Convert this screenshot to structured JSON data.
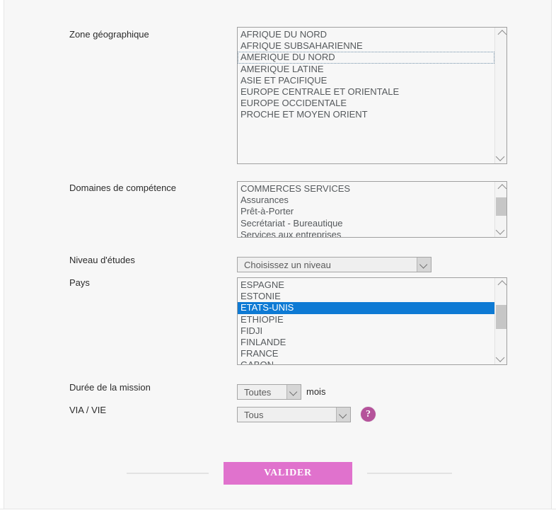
{
  "form": {
    "zone_geographique": {
      "label": "Zone géographique",
      "options": [
        "AFRIQUE DU NORD",
        "AFRIQUE SUBSAHARIENNE",
        "AMERIQUE DU NORD",
        "AMERIQUE LATINE",
        "ASIE ET PACIFIQUE",
        "EUROPE CENTRALE ET ORIENTALE",
        "EUROPE OCCIDENTALE",
        "PROCHE ET MOYEN ORIENT"
      ],
      "focused_index": 2,
      "selected_index": -1
    },
    "domaines_de_competence": {
      "label": "Domaines de compétence",
      "options": [
        "COMMERCES SERVICES",
        "Assurances",
        "Prêt-à-Porter",
        "Secrétariat - Bureautique",
        "Services aux entreprises"
      ],
      "focused_index": -1,
      "selected_index": -1
    },
    "niveau_etudes": {
      "label": "Niveau d'études",
      "value": "Choisissez un niveau"
    },
    "pays": {
      "label": "Pays",
      "options": [
        "ESPAGNE",
        "ESTONIE",
        "ETATS-UNIS",
        "ETHIOPIE",
        "FIDJI",
        "FINLANDE",
        "FRANCE",
        "GABON"
      ],
      "focused_index": -1,
      "selected_index": 2
    },
    "duree_mission": {
      "label": "Durée de la mission",
      "value": "Toutes",
      "suffix": "mois"
    },
    "via_vie": {
      "label": "VIA / VIE",
      "value": "Tous",
      "help_icon": "question-mark-icon",
      "help_glyph": "?"
    },
    "submit": {
      "label": "VALIDER"
    }
  },
  "colors": {
    "accent": "#e072cd",
    "help_badge": "#b5539b",
    "selection": "#0e7ad4",
    "page_bg": "#f7f7f7"
  }
}
